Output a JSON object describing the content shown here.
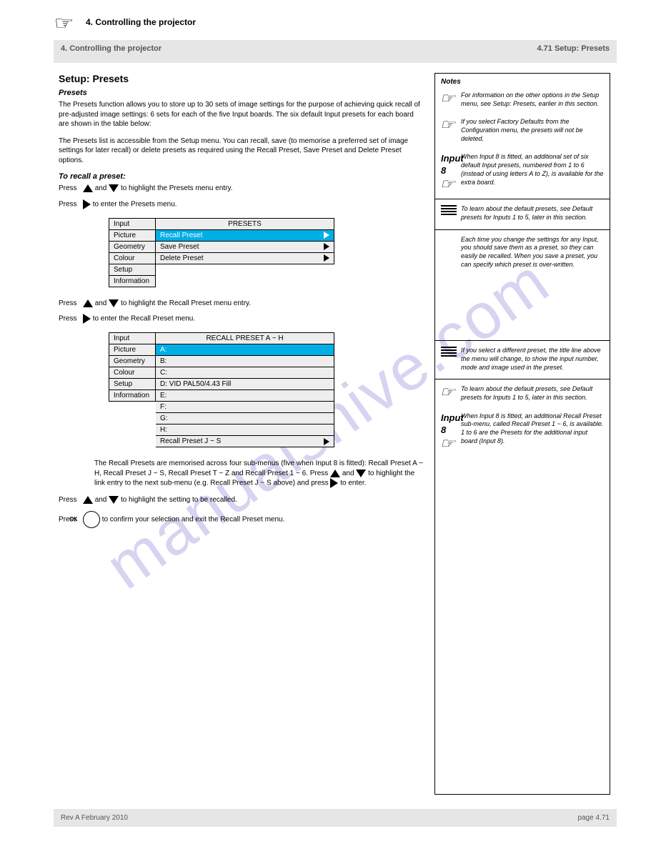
{
  "header": {
    "title_left": "4. Controlling the projector",
    "page_right": "4.71  Setup: Presets",
    "page_section": "4. Controlling the projector"
  },
  "section": {
    "title": "Setup: Presets",
    "sub1": "Presets",
    "intro1": "The Presets function allows you to store up to 30 sets of image settings for the purpose of achieving quick recall of pre-adjusted image settings: 6 sets for each of the five Input boards. The six default Input presets for each board are shown in the table below:",
    "intro2": "The Presets list is accessible from the Setup menu. You can recall, save (to memorise a preferred set of image settings for later recall) or delete presets as required using the Recall Preset, Save Preset and Delete Preset options.",
    "sub2": "To recall a preset:",
    "step1_pre": "Press",
    "step1_mid": " and ",
    "step1_aft": " to highlight the Presets menu entry.",
    "step2_pre": "Press",
    "step2_aft": " to enter the Presets menu.",
    "step3_pre": "Press",
    "step3_mid": " and ",
    "step3_aft": " to highlight the Recall Preset menu entry.",
    "step4_pre": "Press",
    "step4_aft": " to enter the Recall Preset menu.",
    "para_after": "The Recall Presets are memorised across four sub-menus (five when Input 8 is fitted): Recall Preset A ~ H, Recall Preset J ~ S, Recall Preset T ~ Z and Recall Preset 1 ~ 6. Press ",
    "para_after2": " and ",
    "para_after3": " to highlight the link entry to the next sub-menu (e.g. Recall Preset J ~ S above) and press ",
    "para_after4": " to enter.",
    "step5_pre": "Press",
    "step5_mid": " and ",
    "step5_aft": " to highlight the setting to be recalled.",
    "step6_pre": "Press",
    "step6_aft": " to confirm your selection and exit the Recall Preset menu."
  },
  "menu1": {
    "side": [
      "Input",
      "Picture",
      "Geometry",
      "Colour",
      "Setup",
      "Information"
    ],
    "header": "PRESETS",
    "rows": [
      {
        "label": "Recall Preset",
        "arrow": true,
        "sel": true
      },
      {
        "label": "Save Preset",
        "arrow": true,
        "sel": false
      },
      {
        "label": "Delete Preset",
        "arrow": true,
        "sel": false
      }
    ]
  },
  "menu2": {
    "side": [
      "Input",
      "Picture",
      "Geometry",
      "Colour",
      "Setup",
      "Information"
    ],
    "header": "RECALL PRESET A ~ H",
    "rows": [
      {
        "label": "A:",
        "arrow": false,
        "sel": true
      },
      {
        "label": "B:",
        "arrow": false,
        "sel": false
      },
      {
        "label": "C:",
        "arrow": false,
        "sel": false
      },
      {
        "label": "D: VID PAL50/4.43 Fill",
        "arrow": false,
        "sel": false
      },
      {
        "label": "E:",
        "arrow": false,
        "sel": false
      },
      {
        "label": "F:",
        "arrow": false,
        "sel": false
      },
      {
        "label": "G:",
        "arrow": false,
        "sel": false
      },
      {
        "label": "H:",
        "arrow": false,
        "sel": false
      },
      {
        "label": "Recall Preset J ~ S",
        "arrow": true,
        "sel": false
      }
    ]
  },
  "notes": {
    "heading": "Notes",
    "n1": "For information on the other options in the Setup menu, see Setup: Presets, earlier in this section.",
    "n2": "If you select Factory Defaults from the Configuration menu, the presets will not be deleted.",
    "n3_label": "Input 8",
    "n3": "When Input 8 is fitted, an additional set of six default Input presets, numbered from 1 to 6 (instead of using letters A to Z), is available for the extra board.",
    "n4": "To learn about the default presets, see Default presets for Inputs 1 to 5, later in this section.",
    "n5": "Each time you change the settings for any Input, you should save them as a preset, so they can easily be recalled.\nWhen you save a preset, you can specify which preset is over-written.",
    "n6": "If you select a different preset, the title line above the menu will change, to show the input number, mode and image used in the preset.",
    "n7": "To learn about the default presets, see Default presets for Inputs 1 to 5, later in this section.",
    "n8_label": "Input 8",
    "n8": "When Input 8 is fitted, an additional Recall Preset sub-menu, called Recall Preset 1 ~ 6, is available.\n1 to 6 are the Presets for the additional input board (Input 8)."
  },
  "footer": {
    "left": "Rev A    February 2010",
    "right": "page 4.71"
  },
  "watermark": "manualshive.com"
}
